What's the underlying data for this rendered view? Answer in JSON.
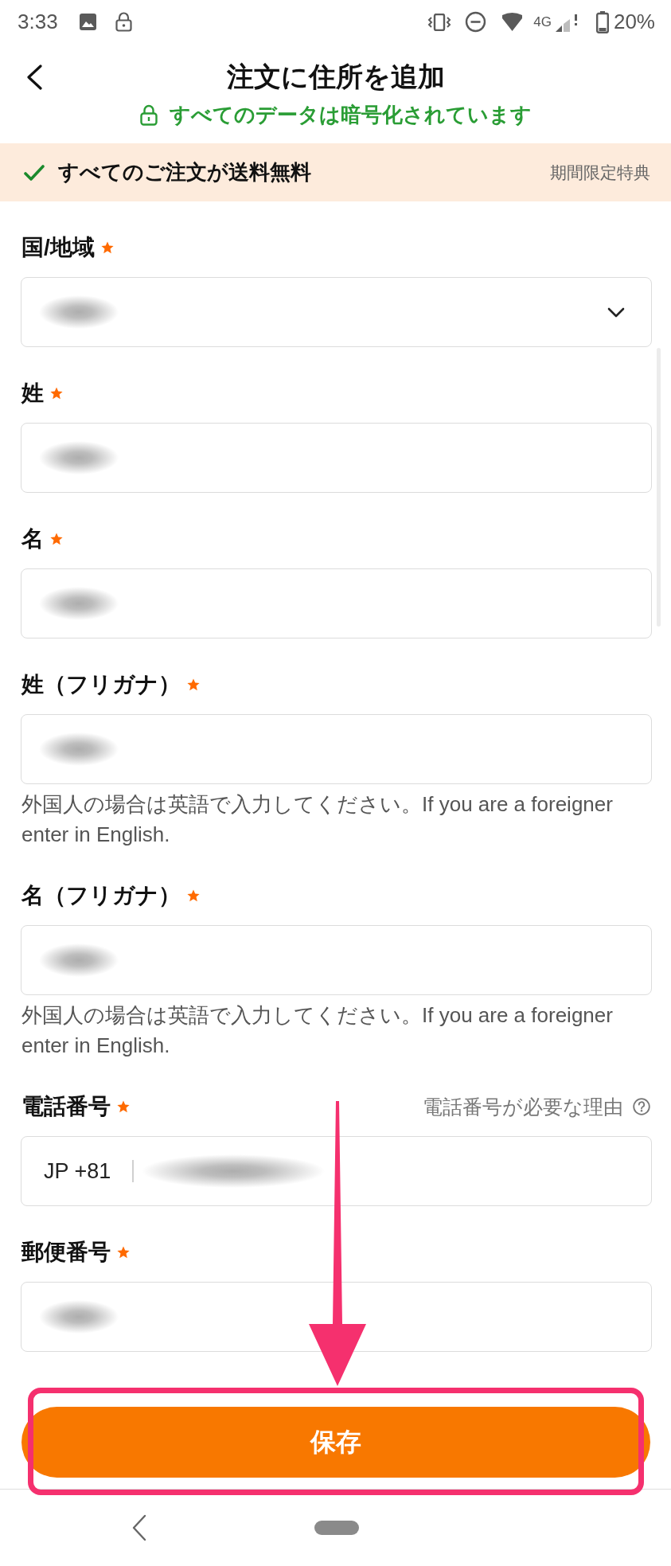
{
  "status_bar": {
    "time": "3:33",
    "network": "4G",
    "battery": "20%"
  },
  "header": {
    "title": "注文に住所を追加",
    "secure_note": "すべてのデータは暗号化されています"
  },
  "banner": {
    "text": "すべてのご注文が送料無料",
    "tag": "期間限定特典"
  },
  "fields": [
    {
      "kind": "select",
      "label": "国/地域",
      "required": true,
      "redacted": true
    },
    {
      "kind": "text",
      "label": "姓",
      "required": true,
      "redacted": true
    },
    {
      "kind": "text",
      "label": "名",
      "required": true,
      "redacted": true
    },
    {
      "kind": "text",
      "label": "姓（フリガナ）",
      "required": true,
      "redacted": true,
      "hint": "外国人の場合は英語で入力してください。If you are a foreigner enter in English."
    },
    {
      "kind": "text",
      "label": "名（フリガナ）",
      "required": true,
      "redacted": true,
      "hint": "外国人の場合は英語で入力してください。If you are a foreigner enter in English."
    },
    {
      "kind": "phone",
      "label": "電話番号",
      "required": true,
      "redacted": true,
      "country_code": "JP +81",
      "help_link": "電話番号が必要な理由"
    },
    {
      "kind": "text",
      "label": "郵便番号",
      "required": true,
      "redacted": true
    }
  ],
  "save_button": {
    "label": "保存"
  },
  "annotations": {
    "arrow": true,
    "highlight_frame": true
  }
}
